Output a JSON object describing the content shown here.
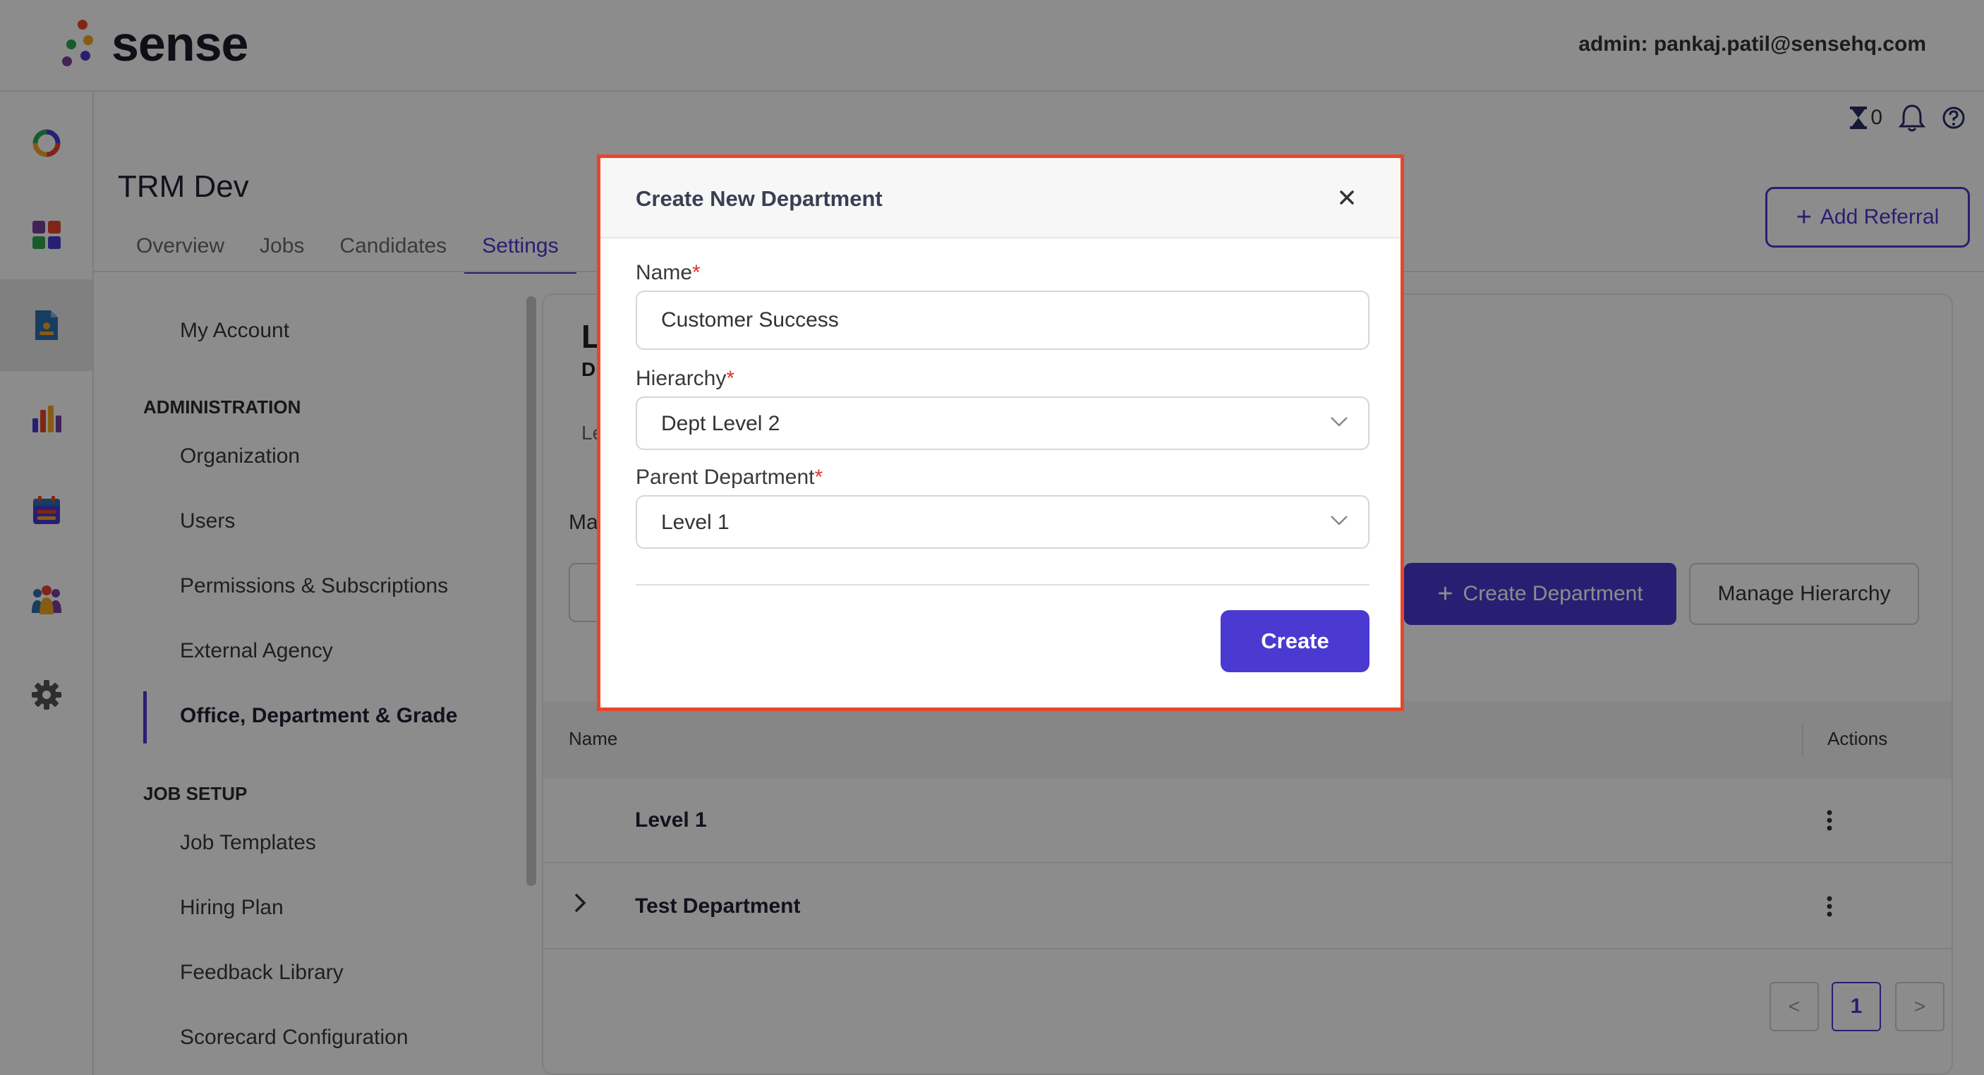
{
  "brand": {
    "name": "sense",
    "dot_colors": [
      "#e8462a",
      "#f5a623",
      "#2fa84f",
      "#4a3ad1",
      "#7b3fa0"
    ]
  },
  "header": {
    "admin_label": "admin: pankaj.patil@sensehq.com",
    "hourglass_count": "0"
  },
  "rail": {
    "items": [
      {
        "icon": "ring-logo-icon"
      },
      {
        "icon": "dashboard-grid-icon"
      },
      {
        "icon": "document-icon",
        "active": true
      },
      {
        "icon": "bar-chart-icon"
      },
      {
        "icon": "calendar-icon"
      },
      {
        "icon": "people-icon"
      },
      {
        "icon": "gear-icon"
      }
    ]
  },
  "page": {
    "title": "TRM Dev",
    "tabs": [
      "Overview",
      "Jobs",
      "Candidates",
      "Settings"
    ],
    "active_tab": "Settings",
    "add_referral": "Add Referral"
  },
  "settings_menu": {
    "my_account": "My Account",
    "admin_heading": "ADMINISTRATION",
    "admin_items": [
      "Organization",
      "Users",
      "Permissions & Subscriptions",
      "External Agency",
      "Office, Department & Grade"
    ],
    "job_setup_heading": "JOB SETUP",
    "job_setup_items": [
      "Job Templates",
      "Hiring Plan",
      "Feedback Library",
      "Scorecard Configuration"
    ]
  },
  "content": {
    "partial_title": "L",
    "partial_subtitle": "D",
    "partial_tab": "Le",
    "partial_label": "Ma",
    "create_department": "Create Department",
    "manage_hierarchy": "Manage Hierarchy",
    "table": {
      "columns": [
        "Name",
        "Actions"
      ],
      "rows": [
        {
          "name": "Level 1",
          "expandable": false
        },
        {
          "name": "Test Department",
          "expandable": true
        }
      ]
    },
    "pagination": {
      "prev": "<",
      "current": "1",
      "next": ">"
    }
  },
  "modal": {
    "title": "Create New Department",
    "name_label": "Name",
    "name_value": "Customer Success",
    "hierarchy_label": "Hierarchy",
    "hierarchy_value": "Dept Level 2",
    "parent_label": "Parent Department",
    "parent_value": "Level 1",
    "required_mark": "*",
    "create_button": "Create",
    "highlight_color": "#e8462a"
  },
  "colors": {
    "accent": "#4a3ad1"
  }
}
